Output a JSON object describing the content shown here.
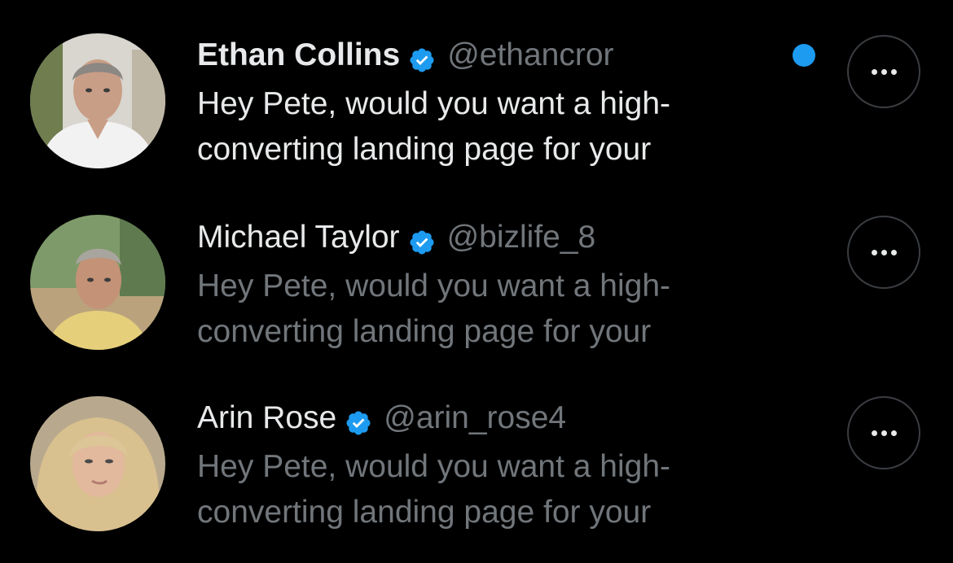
{
  "colors": {
    "background": "#000000",
    "primary_text": "#e7e9ea",
    "secondary_text": "#71767b",
    "verified_blue": "#1d9bf0",
    "unread_dot": "#1d9bf0",
    "button_border": "#3a3d41"
  },
  "icons": {
    "verified": "verified-badge-icon",
    "more": "more-horizontal-icon",
    "unread": "unread-dot-icon"
  },
  "conversations": [
    {
      "name": "Ethan Collins",
      "handle": "@ethancror",
      "verified": true,
      "unread": true,
      "preview_line1": "Hey Pete, would you want a high-",
      "preview_line2": "converting landing page for your"
    },
    {
      "name": "Michael Taylor",
      "handle": "@bizlife_8",
      "verified": true,
      "unread": false,
      "preview_line1": "Hey Pete, would you want a high-",
      "preview_line2": "converting landing page for your"
    },
    {
      "name": "Arin Rose",
      "handle": "@arin_rose4",
      "verified": true,
      "unread": false,
      "preview_line1": "Hey Pete, would you want a high-",
      "preview_line2": "converting landing page for your"
    }
  ]
}
